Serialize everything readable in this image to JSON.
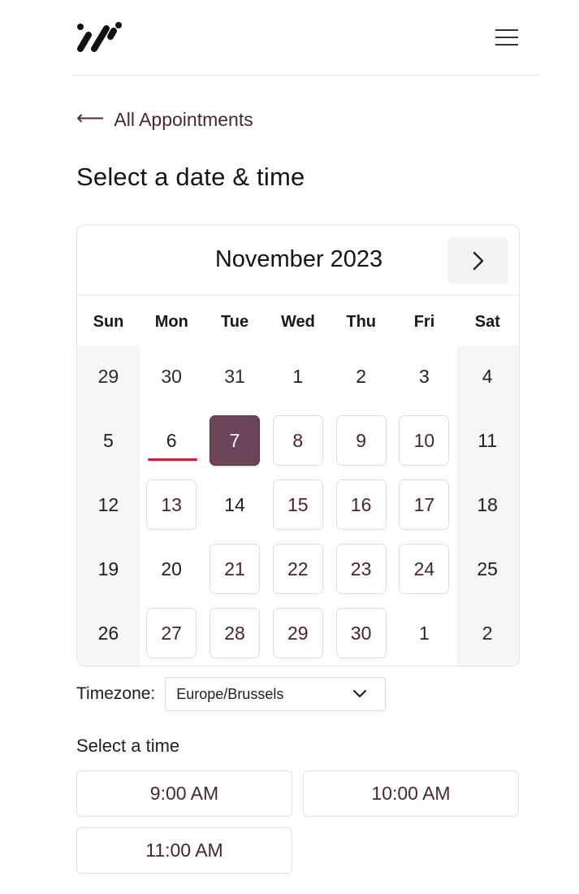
{
  "header": {
    "logo_icon": "brand-logo-icon",
    "menu_icon": "hamburger-menu-icon"
  },
  "back_link": {
    "arrow_icon": "arrow-left-icon",
    "label": "All Appointments"
  },
  "page_title": "Select a date & time",
  "calendar": {
    "month_label": "November 2023",
    "next_icon": "chevron-right-icon",
    "weekdays": [
      "Sun",
      "Mon",
      "Tue",
      "Wed",
      "Thu",
      "Fri",
      "Sat"
    ],
    "weeks": [
      [
        {
          "label": "29",
          "state": "other"
        },
        {
          "label": "30",
          "state": "other"
        },
        {
          "label": "31",
          "state": "other"
        },
        {
          "label": "1",
          "state": "unavailable"
        },
        {
          "label": "2",
          "state": "unavailable"
        },
        {
          "label": "3",
          "state": "unavailable"
        },
        {
          "label": "4",
          "state": "unavailable"
        }
      ],
      [
        {
          "label": "5",
          "state": "unavailable"
        },
        {
          "label": "6",
          "state": "today"
        },
        {
          "label": "7",
          "state": "selected"
        },
        {
          "label": "8",
          "state": "available"
        },
        {
          "label": "9",
          "state": "available"
        },
        {
          "label": "10",
          "state": "available"
        },
        {
          "label": "11",
          "state": "unavailable"
        }
      ],
      [
        {
          "label": "12",
          "state": "unavailable"
        },
        {
          "label": "13",
          "state": "available"
        },
        {
          "label": "14",
          "state": "unavailable"
        },
        {
          "label": "15",
          "state": "available"
        },
        {
          "label": "16",
          "state": "available"
        },
        {
          "label": "17",
          "state": "available"
        },
        {
          "label": "18",
          "state": "unavailable"
        }
      ],
      [
        {
          "label": "19",
          "state": "unavailable"
        },
        {
          "label": "20",
          "state": "unavailable"
        },
        {
          "label": "21",
          "state": "available"
        },
        {
          "label": "22",
          "state": "available"
        },
        {
          "label": "23",
          "state": "available"
        },
        {
          "label": "24",
          "state": "available"
        },
        {
          "label": "25",
          "state": "unavailable"
        }
      ],
      [
        {
          "label": "26",
          "state": "unavailable"
        },
        {
          "label": "27",
          "state": "available"
        },
        {
          "label": "28",
          "state": "available"
        },
        {
          "label": "29",
          "state": "available"
        },
        {
          "label": "30",
          "state": "available"
        },
        {
          "label": "1",
          "state": "other"
        },
        {
          "label": "2",
          "state": "other"
        }
      ]
    ]
  },
  "timezone": {
    "label": "Timezone:",
    "value": "Europe/Brussels",
    "chevron_icon": "chevron-down-icon"
  },
  "time_heading": "Select a time",
  "time_slots": [
    "9:00 AM",
    "10:00 AM",
    "11:00 AM"
  ],
  "colors": {
    "accent": "#6b4459",
    "today_underline": "#d81b36",
    "available_text": "#4b2235"
  }
}
